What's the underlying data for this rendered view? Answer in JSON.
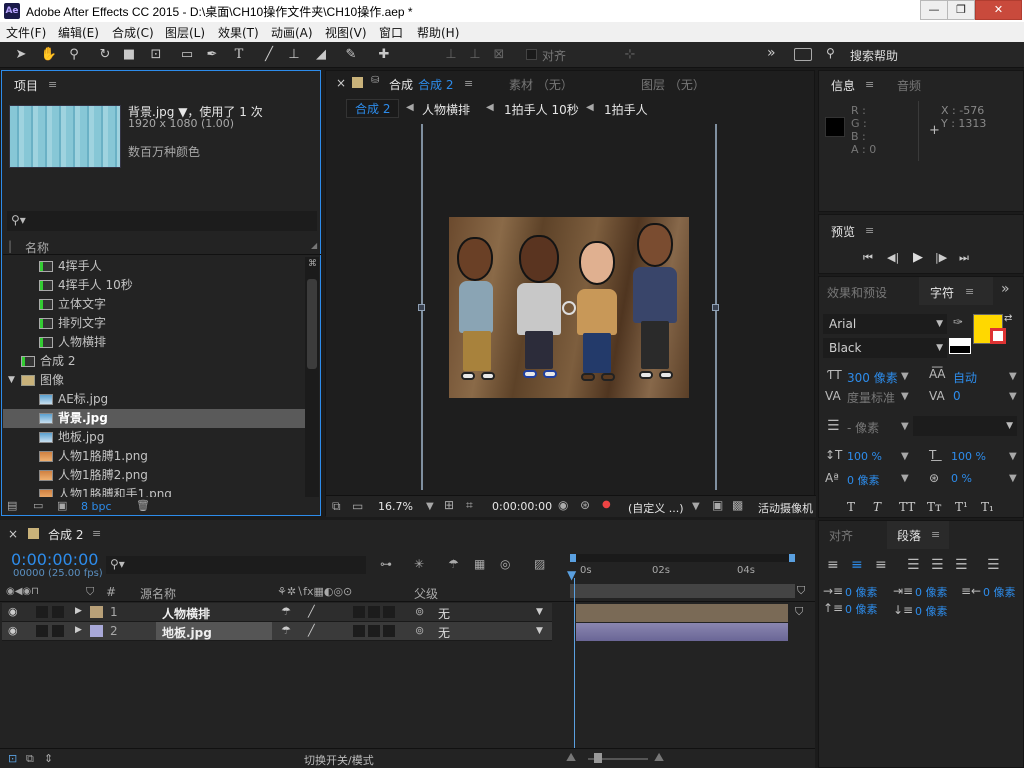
{
  "window": {
    "app_badge": "Ae",
    "title": "Adobe After Effects CC 2015 - D:\\桌面\\CH10操作文件夹\\CH10操作.aep *",
    "min": "—",
    "restore": "❐",
    "close": "✕"
  },
  "menu": [
    "文件(F)",
    "编辑(E)",
    "合成(C)",
    "图层(L)",
    "效果(T)",
    "动画(A)",
    "视图(V)",
    "窗口",
    "帮助(H)"
  ],
  "toolbar": {
    "align_label": "对齐",
    "search_label": "搜索帮助",
    "more": "»"
  },
  "project": {
    "tab": "项目",
    "selected_name": "背景.jpg ▼，使用了 1 次",
    "dims": "1920 x 1080 (1.00)",
    "colors": "数百万种颜色",
    "col_name": "名称",
    "bpc": "8 bpc",
    "items": [
      {
        "label": "4挥手人",
        "type": "comp",
        "indent": 1
      },
      {
        "label": "4挥手人 10秒",
        "type": "comp",
        "indent": 1
      },
      {
        "label": "立体文字",
        "type": "comp",
        "indent": 1
      },
      {
        "label": "排列文字",
        "type": "comp",
        "indent": 1
      },
      {
        "label": "人物横排",
        "type": "comp",
        "indent": 1
      },
      {
        "label": "合成 2",
        "type": "comp",
        "indent": 0
      },
      {
        "label": "图像",
        "type": "folder",
        "indent": 0
      },
      {
        "label": "AE标.jpg",
        "type": "img",
        "indent": 1
      },
      {
        "label": "背景.jpg",
        "type": "img",
        "indent": 1,
        "selected": true
      },
      {
        "label": "地板.jpg",
        "type": "img",
        "indent": 1
      },
      {
        "label": "人物1胳膊1.png",
        "type": "png",
        "indent": 1
      },
      {
        "label": "人物1胳膊2.png",
        "type": "png",
        "indent": 1
      },
      {
        "label": "人物1胳膊和手1.png",
        "type": "png",
        "indent": 1
      }
    ]
  },
  "viewer": {
    "close": "×",
    "lock": "🔒",
    "comp_prefix": "合成",
    "comp_tab": "合成 2",
    "footage_tab": "素材 （无）",
    "layer_tab": "图层 （无）",
    "breadcrumbs": [
      "合成 2",
      "人物横排",
      "1拍手人 10秒",
      "1拍手人"
    ],
    "zoom": "16.7%",
    "timecode": "0:00:00:00",
    "resolution": "(自定义 ...)",
    "camera": "活动摄像机"
  },
  "info": {
    "tab": "信息",
    "tab2": "音频",
    "r": "R :",
    "g": "G :",
    "b": "B :",
    "a": "A : 0",
    "x": "X : -576",
    "y": "Y : 1313"
  },
  "preview": {
    "tab": "预览"
  },
  "character": {
    "tab_effects": "效果和预设",
    "tab": "字符",
    "font": "Arial",
    "style": "Black",
    "size": "300 像素",
    "leading": "自动",
    "kerning": "度量标准",
    "tracking": "0",
    "stroke": "- 像素",
    "vscale": "100 %",
    "hscale": "100 %",
    "baseline": "0 像素",
    "tsume": "0 %",
    "fill_color": "#ffd800"
  },
  "paragraph": {
    "tab_align": "对齐",
    "tab": "段落",
    "indent_left": "0 像素",
    "indent_first": "0 像素",
    "indent_right": "0 像素",
    "space_before": "0 像素",
    "space_after": "0 像素"
  },
  "timeline": {
    "tab": "合成 2",
    "timecode": "0:00:00:00",
    "frames": "00000 (25.00 fps)",
    "col_num": "#",
    "col_source": "源名称",
    "col_parent": "父级",
    "markers": [
      "0s",
      "02s",
      "04s"
    ],
    "layers": [
      {
        "num": "1",
        "name": "人物横排",
        "parent": "无",
        "color": "#b8a078",
        "type": "comp"
      },
      {
        "num": "2",
        "name": "地板.jpg",
        "parent": "无",
        "color": "#a8a8d8",
        "type": "img"
      }
    ],
    "toggle_label": "切换开关/模式"
  }
}
